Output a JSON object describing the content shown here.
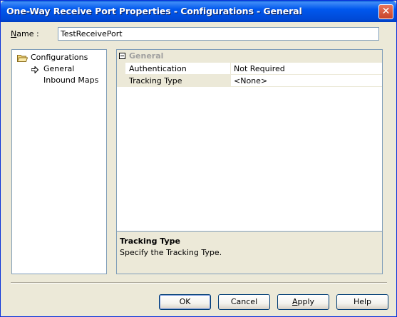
{
  "window": {
    "title": "One-Way Receive Port Properties - Configurations - General",
    "close_symbol": "✕"
  },
  "name_field": {
    "label_mnemonic": "N",
    "label_rest": "ame :",
    "value": "TestReceivePort"
  },
  "tree": {
    "root": {
      "label": "Configurations",
      "icon": "open-folder-icon"
    },
    "children": [
      {
        "label": "General",
        "icon": "arrow-right-icon",
        "selected": true
      },
      {
        "label": "Inbound Maps",
        "selected": false
      }
    ]
  },
  "property_grid": {
    "section_title": "General",
    "collapse_symbol": "minus",
    "rows": [
      {
        "name": "Authentication",
        "value": "Not Required"
      },
      {
        "name": "Tracking Type",
        "value": "<None>"
      }
    ],
    "description": {
      "title": "Tracking Type",
      "text": "Specify the Tracking Type."
    }
  },
  "buttons": {
    "ok": "OK",
    "cancel": "Cancel",
    "apply_mnemonic": "A",
    "apply_rest": "pply",
    "help": "Help"
  },
  "colors": {
    "titlebar": "#0058ee",
    "dialog_bg": "#ece9d8",
    "border": "#7f9db9"
  }
}
